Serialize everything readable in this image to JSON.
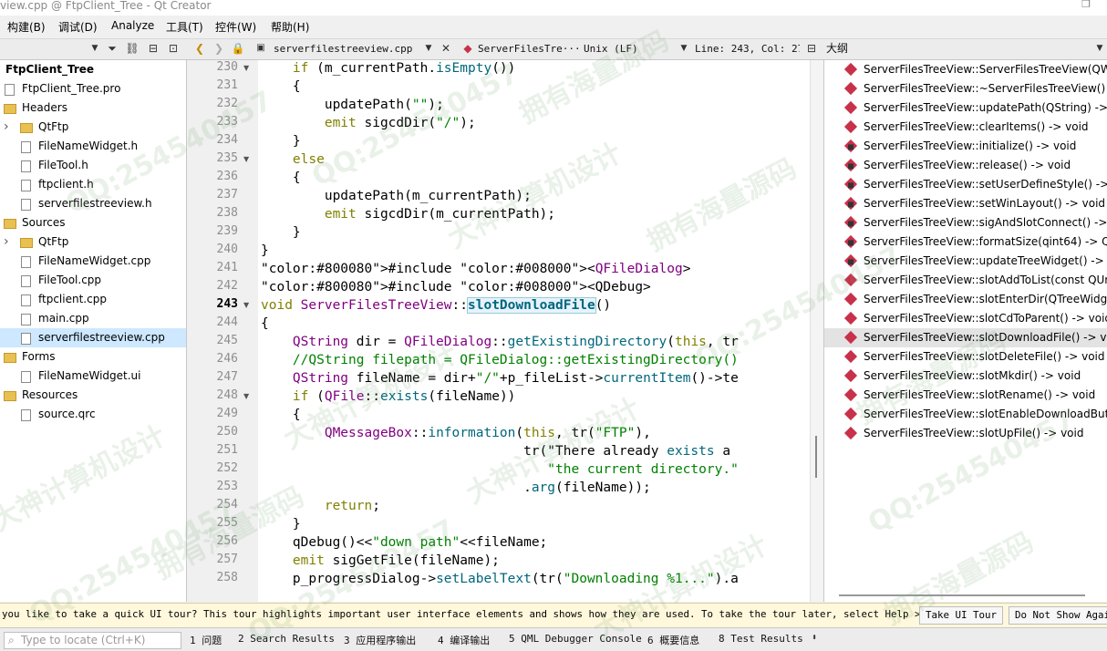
{
  "window": {
    "title": "view.cpp @ FtpClient_Tree - Qt Creator"
  },
  "menu": [
    "构建(B)",
    "调试(D)",
    "Analyze",
    "工具(T)",
    "控件(W)",
    "帮助(H)"
  ],
  "toolbar": {
    "file_combo": "serverfilestreeview.cpp",
    "symbol_combo": "ServerFilesTre···",
    "encoding": "Unix (LF)",
    "position": "Line: 243, Col: 27",
    "outline_title": "大纲"
  },
  "project_tree": [
    {
      "label": "FtpClient_Tree",
      "level": 0,
      "kind": "root"
    },
    {
      "label": "FtpClient_Tree.pro",
      "level": 0,
      "kind": "file"
    },
    {
      "label": "Headers",
      "level": 0,
      "kind": "folder"
    },
    {
      "label": "QtFtp",
      "level": 1,
      "kind": "folder"
    },
    {
      "label": "FileNameWidget.h",
      "level": 1,
      "kind": "file"
    },
    {
      "label": "FileTool.h",
      "level": 1,
      "kind": "file"
    },
    {
      "label": "ftpclient.h",
      "level": 1,
      "kind": "file"
    },
    {
      "label": "serverfilestreeview.h",
      "level": 1,
      "kind": "file"
    },
    {
      "label": "Sources",
      "level": 0,
      "kind": "folder"
    },
    {
      "label": "QtFtp",
      "level": 1,
      "kind": "folder"
    },
    {
      "label": "FileNameWidget.cpp",
      "level": 1,
      "kind": "file"
    },
    {
      "label": "FileTool.cpp",
      "level": 1,
      "kind": "file"
    },
    {
      "label": "ftpclient.cpp",
      "level": 1,
      "kind": "file"
    },
    {
      "label": "main.cpp",
      "level": 1,
      "kind": "file"
    },
    {
      "label": "serverfilestreeview.cpp",
      "level": 1,
      "kind": "file",
      "selected": true
    },
    {
      "label": "Forms",
      "level": 0,
      "kind": "folder"
    },
    {
      "label": "FileNameWidget.ui",
      "level": 1,
      "kind": "file"
    },
    {
      "label": "Resources",
      "level": 0,
      "kind": "folder"
    },
    {
      "label": "source.qrc",
      "level": 1,
      "kind": "file"
    }
  ],
  "editor": {
    "current_line": "243",
    "lines": [
      {
        "n": "230",
        "fold": true,
        "text": "    if (m_currentPath.isEmpty())"
      },
      {
        "n": "231",
        "fold": false,
        "text": "    {"
      },
      {
        "n": "232",
        "fold": false,
        "text": "        updatePath(\"\");"
      },
      {
        "n": "233",
        "fold": false,
        "text": "        emit sigcdDir(\"/\");"
      },
      {
        "n": "234",
        "fold": false,
        "text": "    }"
      },
      {
        "n": "235",
        "fold": true,
        "text": "    else"
      },
      {
        "n": "236",
        "fold": false,
        "text": "    {"
      },
      {
        "n": "237",
        "fold": false,
        "text": "        updatePath(m_currentPath);"
      },
      {
        "n": "238",
        "fold": false,
        "text": "        emit sigcdDir(m_currentPath);"
      },
      {
        "n": "239",
        "fold": false,
        "text": "    }"
      },
      {
        "n": "240",
        "fold": false,
        "text": "}"
      },
      {
        "n": "241",
        "fold": false,
        "text": "#include <QFileDialog>"
      },
      {
        "n": "242",
        "fold": false,
        "text": "#include <QDebug>"
      },
      {
        "n": "243",
        "fold": true,
        "text": "void ServerFilesTreeView::slotDownloadFile()"
      },
      {
        "n": "244",
        "fold": false,
        "text": "{"
      },
      {
        "n": "245",
        "fold": false,
        "text": "    QString dir = QFileDialog::getExistingDirectory(this, tr"
      },
      {
        "n": "246",
        "fold": false,
        "text": "    //QString filepath = QFileDialog::getExistingDirectory()"
      },
      {
        "n": "247",
        "fold": false,
        "text": "    QString fileName = dir+\"/\"+p_fileList->currentItem()->te"
      },
      {
        "n": "248",
        "fold": true,
        "text": "    if (QFile::exists(fileName))"
      },
      {
        "n": "249",
        "fold": false,
        "text": "    {"
      },
      {
        "n": "250",
        "fold": false,
        "text": "        QMessageBox::information(this, tr(\"FTP\"),"
      },
      {
        "n": "251",
        "fold": false,
        "text": "                                 tr(\"There already exists a"
      },
      {
        "n": "252",
        "fold": false,
        "text": "                                    \"the current directory.\""
      },
      {
        "n": "253",
        "fold": false,
        "text": "                                 .arg(fileName));"
      },
      {
        "n": "254",
        "fold": false,
        "text": "        return;"
      },
      {
        "n": "255",
        "fold": false,
        "text": "    }"
      },
      {
        "n": "256",
        "fold": false,
        "text": "    qDebug()<<\"down path\"<<fileName;"
      },
      {
        "n": "257",
        "fold": false,
        "text": "    emit sigGetFile(fileName);"
      },
      {
        "n": "258",
        "fold": false,
        "text": "    p_progressDialog->setLabelText(tr(\"Downloading %1...\").a"
      }
    ]
  },
  "outline": [
    {
      "label": "ServerFilesTreeView::ServerFilesTreeView(QWid",
      "locked": false
    },
    {
      "label": "ServerFilesTreeView::~ServerFilesTreeView() ->",
      "locked": false
    },
    {
      "label": "ServerFilesTreeView::updatePath(QString) -> v",
      "locked": false
    },
    {
      "label": "ServerFilesTreeView::clearItems() -> void",
      "locked": false
    },
    {
      "label": "ServerFilesTreeView::initialize() -> void",
      "locked": true
    },
    {
      "label": "ServerFilesTreeView::release() -> void",
      "locked": true
    },
    {
      "label": "ServerFilesTreeView::setUserDefineStyle() -> vo",
      "locked": true
    },
    {
      "label": "ServerFilesTreeView::setWinLayout() -> void",
      "locked": true
    },
    {
      "label": "ServerFilesTreeView::sigAndSlotConnect() -> vo",
      "locked": true
    },
    {
      "label": "ServerFilesTreeView::formatSize(qint64) -> QSt",
      "locked": true
    },
    {
      "label": "ServerFilesTreeView::updateTreeWidget() -> vo",
      "locked": true
    },
    {
      "label": "ServerFilesTreeView::slotAddToList(const QUrlI",
      "locked": false
    },
    {
      "label": "ServerFilesTreeView::slotEnterDir(QTreeWidge",
      "locked": false
    },
    {
      "label": "ServerFilesTreeView::slotCdToParent() -> void",
      "locked": false
    },
    {
      "label": "ServerFilesTreeView::slotDownloadFile() -> voi",
      "locked": false,
      "selected": true
    },
    {
      "label": "ServerFilesTreeView::slotDeleteFile() -> void",
      "locked": false
    },
    {
      "label": "ServerFilesTreeView::slotMkdir() -> void",
      "locked": false
    },
    {
      "label": "ServerFilesTreeView::slotRename() -> void",
      "locked": false
    },
    {
      "label": "ServerFilesTreeView::slotEnableDownloadButto",
      "locked": false
    },
    {
      "label": "ServerFilesTreeView::slotUpFile() -> void",
      "locked": false
    }
  ],
  "tour": {
    "message": "you like to take a quick UI tour? This tour highlights important user interface elements and shows how they are used. To take the tour later, select Help > UI Tour.",
    "take_button": "Take UI Tour",
    "dismiss_button": "Do Not Show Again"
  },
  "status": {
    "locator_placeholder": "Type to locate (Ctrl+K)",
    "output_tabs": [
      "1 问题",
      "2 Search Results",
      "3 应用程序输出",
      "4 编译输出",
      "5 QML Debugger Console",
      "6 概要信息",
      "8 Test Results"
    ]
  },
  "watermarks": [
    "QQ:254540457",
    "拥有海量源码",
    "大神计算机设计"
  ],
  "colors": {
    "keyword": "#808000",
    "type": "#800080",
    "string": "#008000",
    "comment": "#008000",
    "function": "#00677c",
    "selection": "#cde8ff"
  }
}
